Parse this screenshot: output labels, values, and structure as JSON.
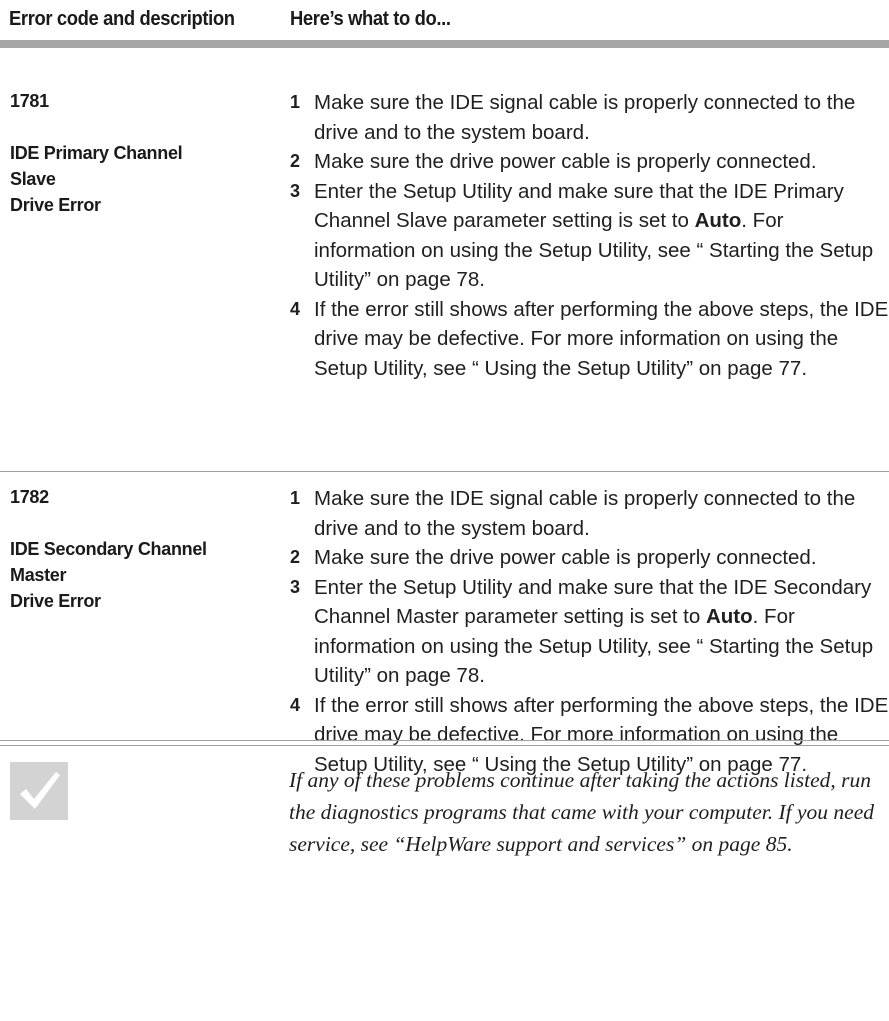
{
  "header": {
    "left_title": "Error code and description",
    "right_title": "Here’s what to do..."
  },
  "errors": [
    {
      "code": "1781",
      "description_lines": [
        "IDE Primary Channel",
        "Slave",
        "Drive Error"
      ],
      "steps": [
        {
          "num": "1",
          "text": "Make sure the IDE signal cable is properly connected to the drive and to the system board."
        },
        {
          "num": "2",
          "text": "Make sure the drive power cable is properly connected."
        },
        {
          "num": "3",
          "pre": "Enter the Setup Utility and make sure that the IDE Primary Channel Slave parameter setting is set to ",
          "bold": "Auto",
          "post": ". For information on using the Setup Utility, see “ Starting the Setup Utility” on page 78."
        },
        {
          "num": "4",
          "text": "If the error still shows after performing the above steps, the IDE drive may be defective. For more information on using the Setup Utility, see “ Using the Setup Utility” on page 77."
        }
      ]
    },
    {
      "code": "1782",
      "description_lines": [
        "IDE Secondary Channel",
        "Master",
        "Drive Error"
      ],
      "steps": [
        {
          "num": "1",
          "text": "Make sure the IDE signal cable is properly connected to the drive and to the system board."
        },
        {
          "num": "2",
          "text": "Make sure the drive power cable is properly connected."
        },
        {
          "num": "3",
          "pre": "Enter the Setup Utility and make sure that the IDE Secondary Channel Master parameter setting is set to ",
          "bold": "Auto",
          "post": ". For information on using the Setup Utility, see “ Starting the Setup Utility” on page 78."
        },
        {
          "num": "4",
          "text": "If the error still shows after performing the above steps, the IDE drive may be defective. For more information on using the Setup Utility, see “ Using the Setup Utility” on page 77."
        }
      ]
    }
  ],
  "note": {
    "icon": "checkmark-icon",
    "text": "If any of these problems continue after taking the actions listed, run the diagnostics programs that came with your computer. If you need service, see “HelpWare support and services” on page 85."
  },
  "colors": {
    "header_rule": "#a6a6a6",
    "row_rule": "#a0a0a0",
    "icon_bg": "#d3d3d3"
  }
}
